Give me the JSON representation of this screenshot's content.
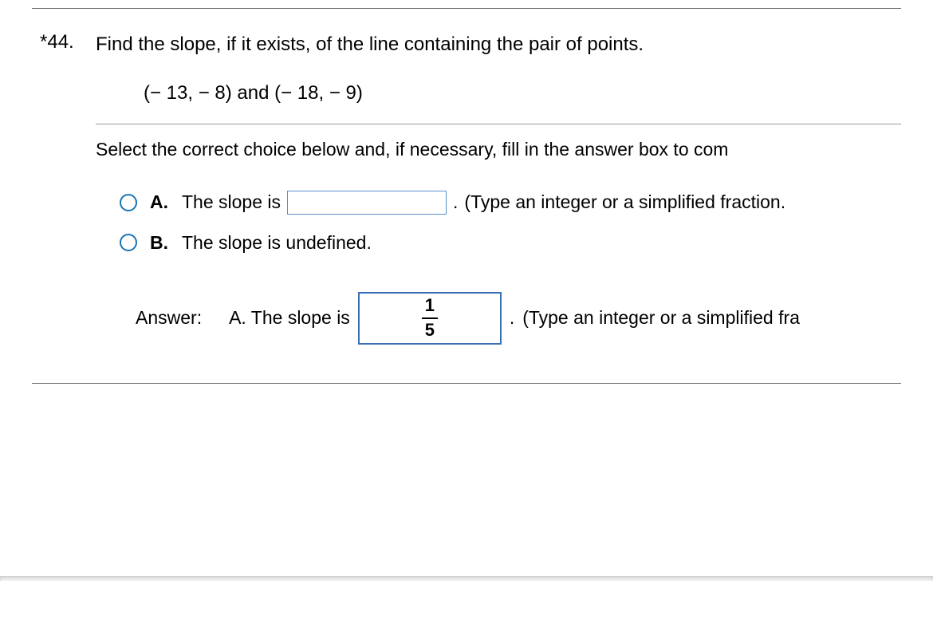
{
  "question": {
    "number": "*44.",
    "prompt": "Find the slope, if it exists, of the line containing the pair of points.",
    "points": "(− 13, − 8) and (− 18, − 9)"
  },
  "instruction": "Select the correct choice below and, if necessary, fill in the answer box to com",
  "choices": {
    "a": {
      "label": "A.",
      "text_before": "The slope is",
      "period": ".",
      "hint": "(Type an integer or a simplified fraction."
    },
    "b": {
      "label": "B.",
      "text": "The slope is undefined."
    }
  },
  "answer": {
    "label": "Answer:",
    "letter_text": "A. The slope is",
    "value_numerator": "1",
    "value_denominator": "5",
    "period": ".",
    "hint": "(Type an integer or a simplified fra"
  }
}
